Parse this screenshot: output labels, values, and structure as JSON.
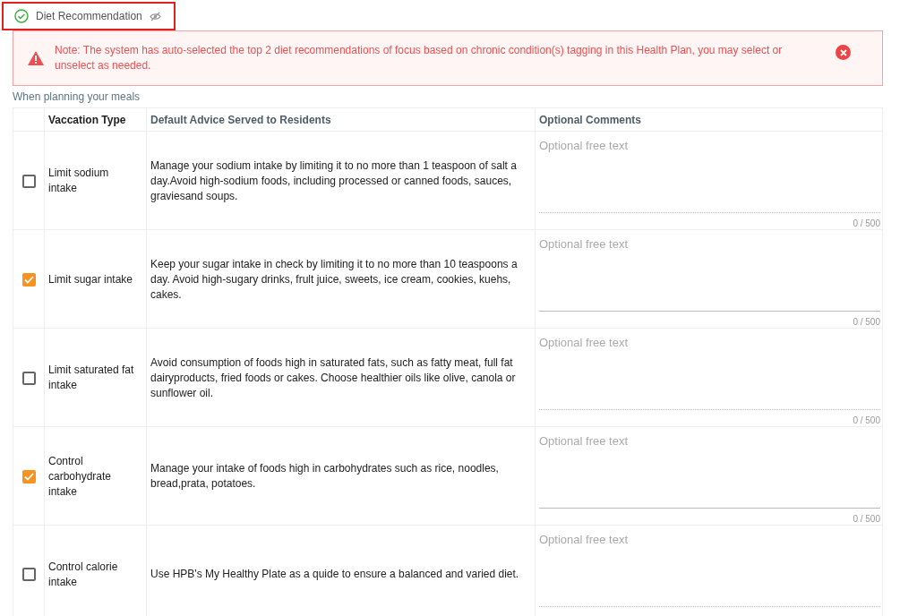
{
  "section": {
    "title": "Diet Recommendation",
    "highlighted": true
  },
  "alert": {
    "text": "Note: The system has auto-selected the top 2 diet recommendations of focus based on chronic condition(s) tagging in this Health Plan, you may select or unselect as needed."
  },
  "subtitle": "When planning your meals",
  "table": {
    "columns": [
      "Vaccation Type",
      "Default Advice Served to Residents",
      "Optional Comments"
    ],
    "rows": [
      {
        "checked": false,
        "type": "Limit sodium intake",
        "advice": "Manage your sodium intake by limiting it to no more than 1 teaspoon of salt a day.Avoid high-sodium foods, including processed or canned foods, sauces, graviesand soups.",
        "placeholder": "Optional free text",
        "counter": "0 / 500"
      },
      {
        "checked": true,
        "type": "Limit sugar intake",
        "advice": "Keep your sugar intake in check by limiting it to no more than 10 teaspoons a day. Avoid high-sugary drinks, frult juice, sweets, ice cream, cookies, kuehs, cakes.",
        "placeholder": "Optional free text",
        "counter": "0 / 500"
      },
      {
        "checked": false,
        "type": "Limit saturated fat intake",
        "advice": "Avoid consumption of foods high in saturated fats, such as fatty meat, full fat dairyproducts, fried foods or cakes. Choose healthier oils like olive, canola or sunflower oil.",
        "placeholder": "Optional free text",
        "counter": "0 / 500"
      },
      {
        "checked": true,
        "type": "Control carbohydrate intake",
        "advice": "Manage your intake of foods high in carbohydrates such as rice, noodles, bread,prata, potatoes.",
        "placeholder": "Optional free text",
        "counter": "0 / 500"
      },
      {
        "checked": false,
        "type": "Control calorie intake",
        "advice": "Use HPB's My Healthy Plate as a quide to ensure a balanced and varied diet.",
        "placeholder": "Optional free text"
      }
    ]
  }
}
